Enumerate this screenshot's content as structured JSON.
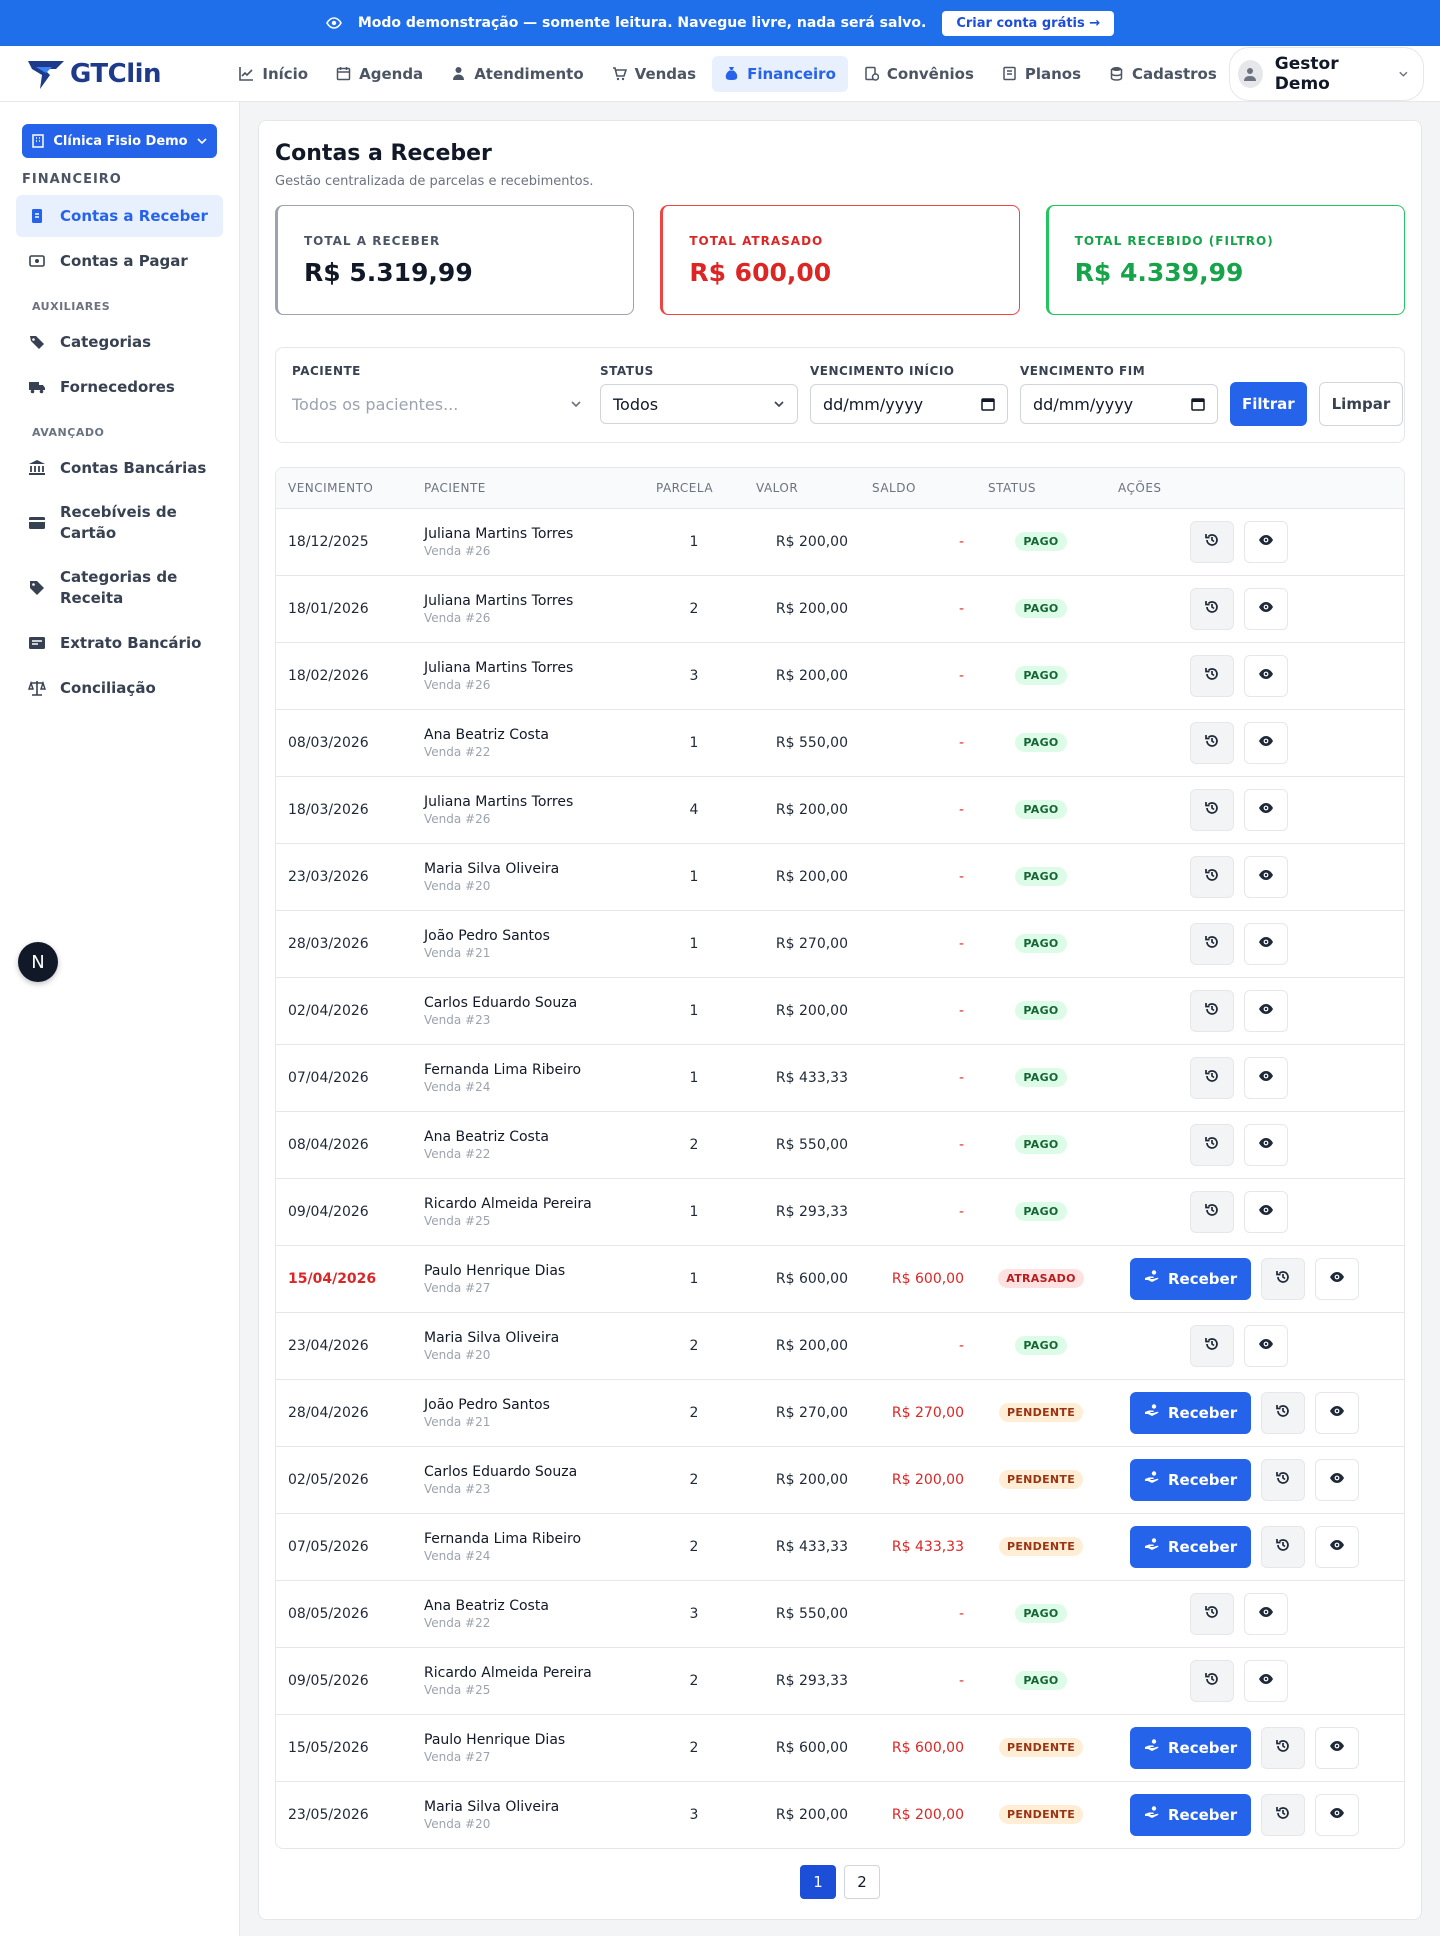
{
  "banner": {
    "icon": "eye-icon",
    "text": "Modo demonstração — somente leitura. Navegue livre, nada será salvo.",
    "cta": "Criar conta grátis →"
  },
  "brand": {
    "name": "GTClin",
    "color": "#1e3a8a"
  },
  "nav": {
    "items": [
      {
        "label": "Início",
        "icon": "chart-line-icon",
        "active": false
      },
      {
        "label": "Agenda",
        "icon": "calendar-icon",
        "active": false
      },
      {
        "label": "Atendimento",
        "icon": "user-doctor-icon",
        "active": false
      },
      {
        "label": "Vendas",
        "icon": "cart-icon",
        "active": false
      },
      {
        "label": "Financeiro",
        "icon": "money-bag-icon",
        "active": true
      },
      {
        "label": "Convênios",
        "icon": "insurance-icon",
        "active": false
      },
      {
        "label": "Planos",
        "icon": "plans-icon",
        "active": false
      },
      {
        "label": "Cadastros",
        "icon": "database-icon",
        "active": false
      }
    ],
    "user": "Gestor Demo"
  },
  "sidebar": {
    "clinic": "Clínica Fisio Demo",
    "section": "FINANCEIRO",
    "main_items": [
      {
        "label": "Contas a Receber",
        "icon": "receivable-icon",
        "active": true
      },
      {
        "label": "Contas a Pagar",
        "icon": "payable-icon",
        "active": false
      }
    ],
    "aux_title": "AUXILIARES",
    "aux_items": [
      {
        "label": "Categorias",
        "icon": "tags-icon"
      },
      {
        "label": "Fornecedores",
        "icon": "truck-icon"
      }
    ],
    "adv_title": "AVANÇADO",
    "adv_items": [
      {
        "label": "Contas Bancárias",
        "icon": "bank-icon"
      },
      {
        "label": "Recebíveis de Cartão",
        "icon": "credit-card-icon"
      },
      {
        "label": "Categorias de Receita",
        "icon": "tag-icon"
      },
      {
        "label": "Extrato Bancário",
        "icon": "statement-icon"
      },
      {
        "label": "Conciliação",
        "icon": "scale-icon"
      }
    ],
    "badge": "N"
  },
  "page": {
    "title": "Contas a Receber",
    "subtitle": "Gestão centralizada de parcelas e recebimentos."
  },
  "stats": [
    {
      "label": "TOTAL A RECEBER",
      "value": "R$ 5.319,99",
      "tone": "neutral"
    },
    {
      "label": "TOTAL ATRASADO",
      "value": "R$ 600,00",
      "tone": "red"
    },
    {
      "label": "TOTAL RECEBIDO (FILTRO)",
      "value": "R$ 4.339,99",
      "tone": "green"
    }
  ],
  "filters": {
    "patient_label": "PACIENTE",
    "patient_placeholder": "Todos os pacientes...",
    "status_label": "STATUS",
    "status_value": "Todos",
    "start_label": "VENCIMENTO INÍCIO",
    "start_value": "dd/mm/yyyy",
    "end_label": "VENCIMENTO FIM",
    "end_value": "dd/mm/yyyy",
    "filter_btn": "Filtrar",
    "clear_btn": "Limpar"
  },
  "table": {
    "headers": [
      "VENCIMENTO",
      "PACIENTE",
      "PARCELA",
      "VALOR",
      "SALDO",
      "STATUS",
      "AÇÕES"
    ],
    "receive_label": "Receber",
    "rows": [
      {
        "due": "18/12/2025",
        "patient": "Juliana Martins Torres",
        "sale": "Venda #26",
        "installment": "1",
        "value": "R$ 200,00",
        "balance": "-",
        "status": "PAGO",
        "overdue": false
      },
      {
        "due": "18/01/2026",
        "patient": "Juliana Martins Torres",
        "sale": "Venda #26",
        "installment": "2",
        "value": "R$ 200,00",
        "balance": "-",
        "status": "PAGO",
        "overdue": false
      },
      {
        "due": "18/02/2026",
        "patient": "Juliana Martins Torres",
        "sale": "Venda #26",
        "installment": "3",
        "value": "R$ 200,00",
        "balance": "-",
        "status": "PAGO",
        "overdue": false
      },
      {
        "due": "08/03/2026",
        "patient": "Ana Beatriz Costa",
        "sale": "Venda #22",
        "installment": "1",
        "value": "R$ 550,00",
        "balance": "-",
        "status": "PAGO",
        "overdue": false
      },
      {
        "due": "18/03/2026",
        "patient": "Juliana Martins Torres",
        "sale": "Venda #26",
        "installment": "4",
        "value": "R$ 200,00",
        "balance": "-",
        "status": "PAGO",
        "overdue": false
      },
      {
        "due": "23/03/2026",
        "patient": "Maria Silva Oliveira",
        "sale": "Venda #20",
        "installment": "1",
        "value": "R$ 200,00",
        "balance": "-",
        "status": "PAGO",
        "overdue": false
      },
      {
        "due": "28/03/2026",
        "patient": "João Pedro Santos",
        "sale": "Venda #21",
        "installment": "1",
        "value": "R$ 270,00",
        "balance": "-",
        "status": "PAGO",
        "overdue": false
      },
      {
        "due": "02/04/2026",
        "patient": "Carlos Eduardo Souza",
        "sale": "Venda #23",
        "installment": "1",
        "value": "R$ 200,00",
        "balance": "-",
        "status": "PAGO",
        "overdue": false
      },
      {
        "due": "07/04/2026",
        "patient": "Fernanda Lima Ribeiro",
        "sale": "Venda #24",
        "installment": "1",
        "value": "R$ 433,33",
        "balance": "-",
        "status": "PAGO",
        "overdue": false
      },
      {
        "due": "08/04/2026",
        "patient": "Ana Beatriz Costa",
        "sale": "Venda #22",
        "installment": "2",
        "value": "R$ 550,00",
        "balance": "-",
        "status": "PAGO",
        "overdue": false
      },
      {
        "due": "09/04/2026",
        "patient": "Ricardo Almeida Pereira",
        "sale": "Venda #25",
        "installment": "1",
        "value": "R$ 293,33",
        "balance": "-",
        "status": "PAGO",
        "overdue": false
      },
      {
        "due": "15/04/2026",
        "patient": "Paulo Henrique Dias",
        "sale": "Venda #27",
        "installment": "1",
        "value": "R$ 600,00",
        "balance": "R$ 600,00",
        "status": "ATRASADO",
        "overdue": true
      },
      {
        "due": "23/04/2026",
        "patient": "Maria Silva Oliveira",
        "sale": "Venda #20",
        "installment": "2",
        "value": "R$ 200,00",
        "balance": "-",
        "status": "PAGO",
        "overdue": false
      },
      {
        "due": "28/04/2026",
        "patient": "João Pedro Santos",
        "sale": "Venda #21",
        "installment": "2",
        "value": "R$ 270,00",
        "balance": "R$ 270,00",
        "status": "PENDENTE",
        "overdue": false
      },
      {
        "due": "02/05/2026",
        "patient": "Carlos Eduardo Souza",
        "sale": "Venda #23",
        "installment": "2",
        "value": "R$ 200,00",
        "balance": "R$ 200,00",
        "status": "PENDENTE",
        "overdue": false
      },
      {
        "due": "07/05/2026",
        "patient": "Fernanda Lima Ribeiro",
        "sale": "Venda #24",
        "installment": "2",
        "value": "R$ 433,33",
        "balance": "R$ 433,33",
        "status": "PENDENTE",
        "overdue": false
      },
      {
        "due": "08/05/2026",
        "patient": "Ana Beatriz Costa",
        "sale": "Venda #22",
        "installment": "3",
        "value": "R$ 550,00",
        "balance": "-",
        "status": "PAGO",
        "overdue": false
      },
      {
        "due": "09/05/2026",
        "patient": "Ricardo Almeida Pereira",
        "sale": "Venda #25",
        "installment": "2",
        "value": "R$ 293,33",
        "balance": "-",
        "status": "PAGO",
        "overdue": false
      },
      {
        "due": "15/05/2026",
        "patient": "Paulo Henrique Dias",
        "sale": "Venda #27",
        "installment": "2",
        "value": "R$ 600,00",
        "balance": "R$ 600,00",
        "status": "PENDENTE",
        "overdue": false
      },
      {
        "due": "23/05/2026",
        "patient": "Maria Silva Oliveira",
        "sale": "Venda #20",
        "installment": "3",
        "value": "R$ 200,00",
        "balance": "R$ 200,00",
        "status": "PENDENTE",
        "overdue": false
      }
    ]
  },
  "pagination": {
    "pages": [
      "1",
      "2"
    ],
    "current": "1"
  },
  "colors": {
    "primary": "#2563eb",
    "danger": "#dc2626",
    "success": "#16a34a",
    "warning": "#9a3412"
  }
}
